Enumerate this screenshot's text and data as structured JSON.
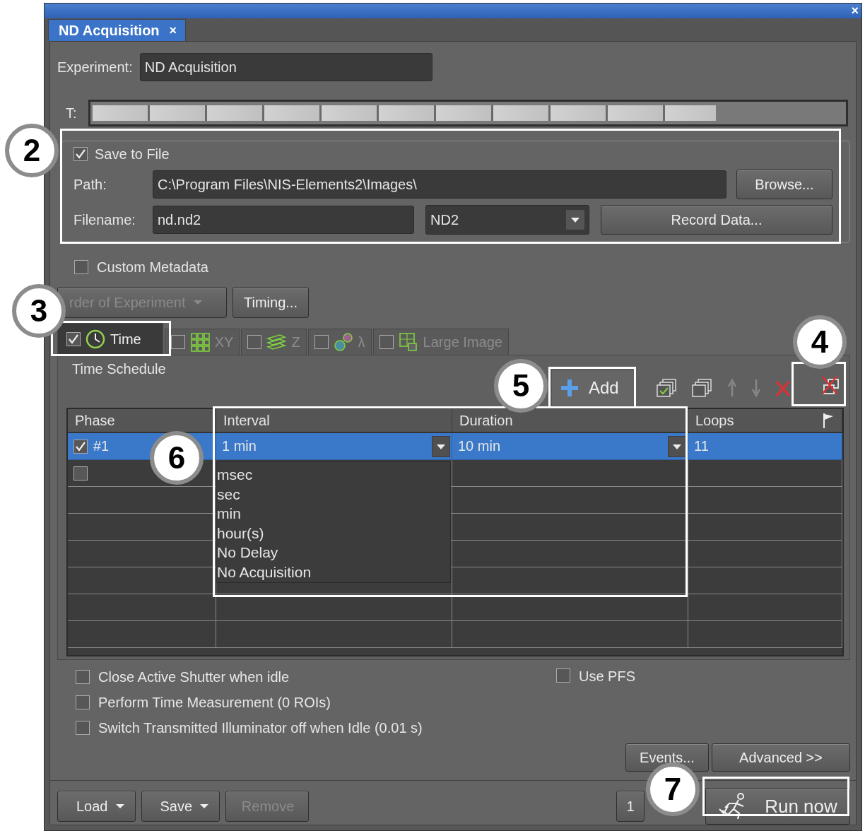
{
  "window": {
    "close": "×"
  },
  "tab": {
    "label": "ND Acquisition",
    "close": "×",
    "selected": true
  },
  "experiment": {
    "label": "Experiment:",
    "value": "ND Acquisition"
  },
  "timeline": {
    "label": "T:",
    "level": 0.83
  },
  "save_to_file": {
    "label": "Save to File",
    "checked": true,
    "path_label": "Path:",
    "path": "C:\\Program Files\\NIS-Elements2\\Images\\",
    "browse": "Browse...",
    "filename_label": "Filename:",
    "filename": "nd.nd2",
    "format": "ND2",
    "record": "Record Data..."
  },
  "custom_metadata": {
    "label": "Custom Metadata",
    "checked": false
  },
  "order_button": {
    "label": "rder of Experiment",
    "disabled": true
  },
  "timing_button": {
    "label": "Timing..."
  },
  "dimension_tabs": [
    {
      "label": "Time",
      "kind": "clock",
      "checked": true,
      "selected": true
    },
    {
      "label": "XY",
      "kind": "grid",
      "checked": false,
      "selected": false
    },
    {
      "label": "Z",
      "kind": "layers",
      "checked": false,
      "selected": false
    },
    {
      "label": "λ",
      "kind": "circles",
      "checked": false,
      "selected": false
    },
    {
      "label": "Large Image",
      "kind": "tiles",
      "checked": false,
      "selected": false
    }
  ],
  "time_schedule": {
    "title": "Time Schedule",
    "add": "Add",
    "columns": [
      "Phase",
      "Interval",
      "Duration",
      "Loops"
    ],
    "rows": [
      {
        "checked": true,
        "selected": true,
        "phase": "#1",
        "interval": "1 min",
        "duration": "10 min",
        "loops": "11"
      },
      {
        "checked": false,
        "selected": false
      }
    ],
    "interval_options": [
      "msec",
      "sec",
      "min",
      "hour(s)",
      "No Delay",
      "No Acquisition"
    ]
  },
  "options": [
    {
      "label": "Close Active Shutter when idle",
      "checked": false
    },
    {
      "label": "Perform Time Measurement (0 ROIs)",
      "checked": false
    },
    {
      "label": "Switch Transmitted Illuminator off when Idle (0.01 s)",
      "checked": false
    }
  ],
  "use_pfs": {
    "label": "Use PFS",
    "checked": false
  },
  "events_button": "Events...",
  "advanced_button": "Advanced >>",
  "bottom": {
    "load": "Load",
    "save": "Save",
    "remove": {
      "label": "Remove",
      "disabled": true
    },
    "count_button": "1",
    "run": "Run now"
  },
  "callouts": [
    {
      "label": "2"
    },
    {
      "label": "3"
    },
    {
      "label": "4"
    },
    {
      "label": "5"
    },
    {
      "label": "6"
    },
    {
      "label": "7"
    }
  ]
}
